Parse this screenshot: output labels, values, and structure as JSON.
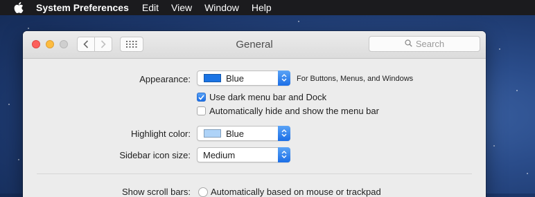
{
  "menubar": {
    "apple_icon": "apple-logo-icon",
    "app_name": "System Preferences",
    "items": [
      "Edit",
      "View",
      "Window",
      "Help"
    ]
  },
  "window": {
    "title": "General",
    "search_placeholder": "Search",
    "icons": {
      "back": "chevron-left-icon",
      "forward": "chevron-right-icon",
      "show_all": "grid-icon",
      "search": "magnifier-icon"
    }
  },
  "appearance": {
    "label": "Appearance:",
    "value": "Blue",
    "swatch_color": "#1b74e4",
    "hint": "For Buttons, Menus, and Windows"
  },
  "options": [
    {
      "label": "Use dark menu bar and Dock",
      "checked": true
    },
    {
      "label": "Automatically hide and show the menu bar",
      "checked": false
    }
  ],
  "highlight": {
    "label": "Highlight color:",
    "value": "Blue",
    "swatch_color": "#aed3f8"
  },
  "sidebar_icon_size": {
    "label": "Sidebar icon size:",
    "value": "Medium"
  },
  "scroll_bars": {
    "label": "Show scroll bars:",
    "option": "Automatically based on mouse or trackpad"
  },
  "colors": {
    "accent": "#1b6ee6",
    "close": "#fc605c",
    "minimize": "#fdbc40"
  }
}
